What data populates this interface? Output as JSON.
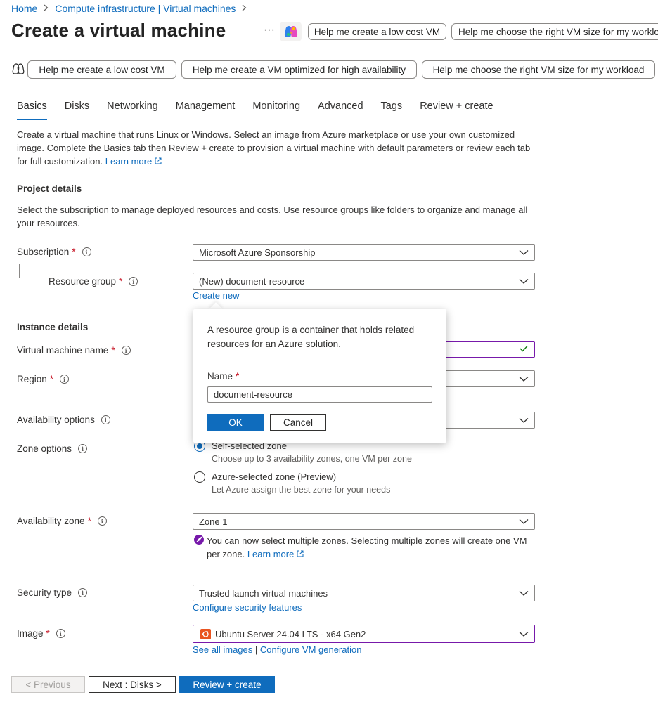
{
  "breadcrumb": {
    "home": "Home",
    "parent": "Compute infrastructure | Virtual machines"
  },
  "page": {
    "title": "Create a virtual machine",
    "more": "···"
  },
  "header_prompts": [
    "Help me create a low cost VM",
    "Help me choose the right VM size for my worklo"
  ],
  "prompts": [
    "Help me create a low cost VM",
    "Help me create a VM optimized for high availability",
    "Help me choose the right VM size for my workload"
  ],
  "tabs": [
    "Basics",
    "Disks",
    "Networking",
    "Management",
    "Monitoring",
    "Advanced",
    "Tags",
    "Review + create"
  ],
  "intro": {
    "text": "Create a virtual machine that runs Linux or Windows. Select an image from Azure marketplace or use your own customized image. Complete the Basics tab then Review + create to provision a virtual machine with default parameters or review each tab for full customization. ",
    "learn_more": "Learn more"
  },
  "project": {
    "heading": "Project details",
    "text": "Select the subscription to manage deployed resources and costs. Use resource groups like folders to organize and manage all your resources.",
    "subscription_label": "Subscription",
    "subscription_value": "Microsoft Azure Sponsorship",
    "rg_label": "Resource group",
    "rg_value": "(New) document-resource",
    "create_new": "Create new"
  },
  "instance": {
    "heading": "Instance details",
    "vm_name_label": "Virtual machine name",
    "region_label": "Region",
    "availability_label": "Availability options",
    "zone_options_label": "Zone options",
    "zone_self": "Self-selected zone",
    "zone_self_desc": "Choose up to 3 availability zones, one VM per zone",
    "zone_azure": "Azure-selected zone (Preview)",
    "zone_azure_desc": "Let Azure assign the best zone for your needs",
    "az_label": "Availability zone",
    "az_value": "Zone 1",
    "az_note": "You can now select multiple zones. Selecting multiple zones will create one VM per zone. ",
    "az_learn_more": "Learn more",
    "security_label": "Security type",
    "security_value": "Trusted launch virtual machines",
    "configure_security": "Configure security features",
    "image_label": "Image",
    "image_value": "Ubuntu Server 24.04 LTS - x64 Gen2",
    "see_all_images": "See all images",
    "link_sep": "|",
    "configure_vm_gen": "Configure VM generation"
  },
  "popup": {
    "text": "A resource group is a container that holds related resources for an Azure solution.",
    "name_label": "Name",
    "name_value": "document-resource",
    "ok": "OK",
    "cancel": "Cancel"
  },
  "footer": {
    "previous": "< Previous",
    "next": "Next : Disks >",
    "review": "Review + create"
  },
  "required_mark": "*",
  "info_mark": "i",
  "colors": {
    "accent": "#0f6cbd",
    "required": "#c50f1f",
    "success": "#107c10",
    "purple": "#7719aa",
    "ubuntu": "#e95420"
  }
}
